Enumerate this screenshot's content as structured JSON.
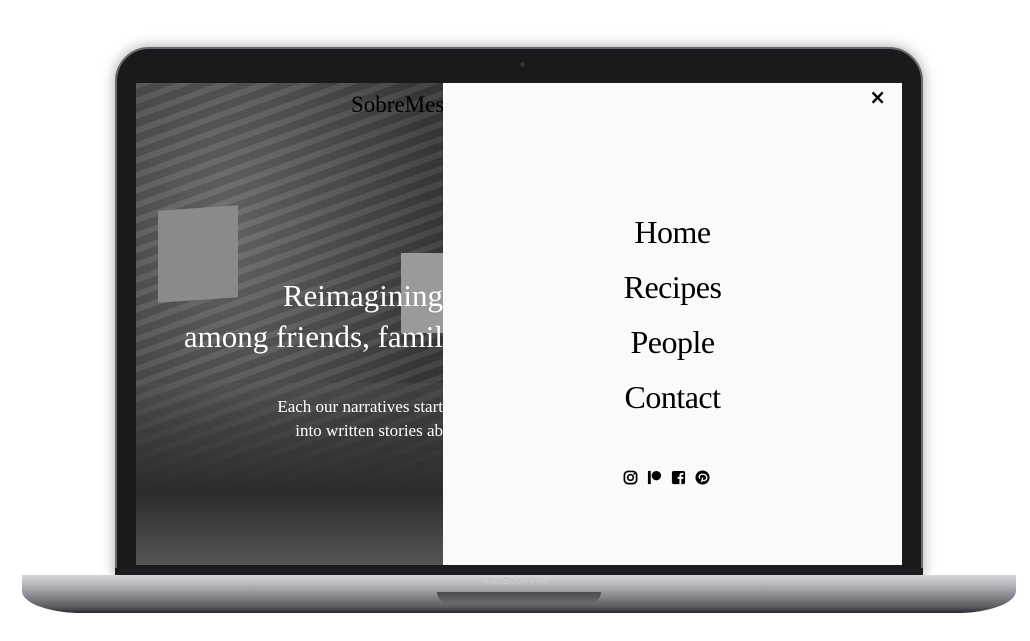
{
  "device": {
    "label": "MacBook Pro"
  },
  "site": {
    "logo": "SobreMesa",
    "hero": {
      "line1": "Reimagining",
      "line2": "among friends, famil",
      "sub1": "Each our narratives start",
      "sub2": "into written stories ab"
    },
    "menu": {
      "close_icon": "×",
      "items": [
        {
          "label": "Home"
        },
        {
          "label": "Recipes"
        },
        {
          "label": "People"
        },
        {
          "label": "Contact"
        }
      ]
    },
    "social": [
      "instagram-icon",
      "patreon-icon",
      "facebook-icon",
      "pinterest-icon"
    ]
  }
}
